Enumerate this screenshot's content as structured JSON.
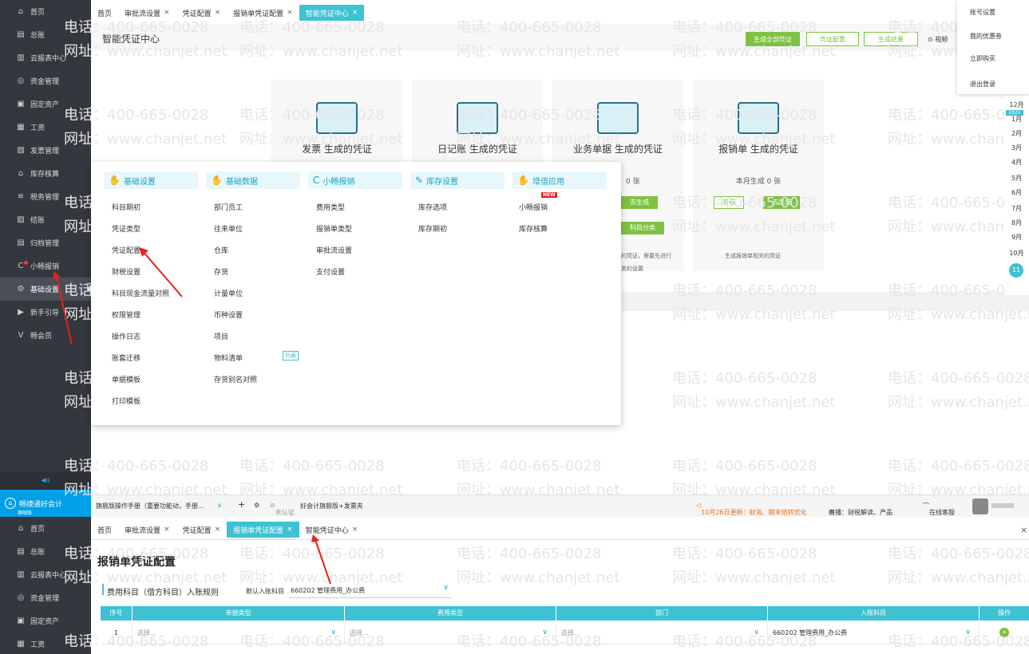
{
  "sidebar_top": [
    {
      "icon": "home-icon",
      "glyph": "⌂",
      "label": "首页"
    },
    {
      "icon": "ledger-icon",
      "glyph": "▤",
      "label": "总账"
    },
    {
      "icon": "chart-icon",
      "glyph": "▥",
      "label": "云报表中心"
    },
    {
      "icon": "money-icon",
      "glyph": "◎",
      "label": "资金管理"
    },
    {
      "icon": "asset-icon",
      "glyph": "▣",
      "label": "固定资产"
    },
    {
      "icon": "salary-icon",
      "glyph": "▦",
      "label": "工资"
    },
    {
      "icon": "invoice-icon",
      "glyph": "▧",
      "label": "发票管理"
    },
    {
      "icon": "warehouse-icon",
      "glyph": "⌂",
      "label": "库存核算"
    },
    {
      "icon": "tax-icon",
      "glyph": "≡",
      "label": "税务管理"
    },
    {
      "icon": "close-account-icon",
      "glyph": "▨",
      "label": "结账"
    },
    {
      "icon": "archive-icon",
      "glyph": "▤",
      "label": "归档管理"
    },
    {
      "icon": "reimburse-icon",
      "glyph": "C",
      "label": "小畅报销"
    },
    {
      "icon": "gear-icon",
      "glyph": "⚙",
      "label": "基础设置"
    },
    {
      "icon": "guide-icon",
      "glyph": "▶",
      "label": "新手引导"
    },
    {
      "icon": "vip-icon",
      "glyph": "V",
      "label": "畅会员"
    }
  ],
  "sidebar_bottom": [
    {
      "icon": "home-icon",
      "glyph": "⌂",
      "label": "首页"
    },
    {
      "icon": "ledger-icon",
      "glyph": "▤",
      "label": "总账"
    },
    {
      "icon": "chart-icon",
      "glyph": "▥",
      "label": "云报表中心"
    },
    {
      "icon": "money-icon",
      "glyph": "◎",
      "label": "资金管理"
    },
    {
      "icon": "asset-icon",
      "glyph": "▣",
      "label": "固定资产"
    },
    {
      "icon": "salary-icon",
      "glyph": "▦",
      "label": "工资"
    }
  ],
  "brand": {
    "name": "畅捷通好会计",
    "sub": "旗舰版"
  },
  "tabs_top": [
    {
      "label": "首页",
      "x": false
    },
    {
      "label": "审批流设置",
      "x": true
    },
    {
      "label": "凭证配置",
      "x": true
    },
    {
      "label": "报销单凭证配置",
      "x": true
    },
    {
      "label": "智能凭证中心",
      "x": true,
      "active": true
    }
  ],
  "tabs_bottom": [
    {
      "label": "首页",
      "x": false
    },
    {
      "label": "审批流设置",
      "x": true
    },
    {
      "label": "凭证配置",
      "x": true
    },
    {
      "label": "报销单凭证配置",
      "x": true,
      "active": true
    },
    {
      "label": "智能凭证中心",
      "x": true
    }
  ],
  "page_title": "智能凭证中心",
  "top_buttons": {
    "generate_all": "生成全部凭证",
    "voucher_config": "凭证配置",
    "result": "生成结果",
    "video": "视频"
  },
  "account_menu": [
    "账号设置",
    "我的优惠券",
    "立即购买",
    "退出登录"
  ],
  "months": [
    "12月",
    "2021",
    "1月",
    "2月",
    "3月",
    "4月",
    "5月",
    "6月",
    "7月",
    "8月",
    "9月",
    "10月",
    "11月"
  ],
  "cards": [
    {
      "title": "发票 生成的凭证"
    },
    {
      "title": "日记账 生成的凭证"
    },
    {
      "title": "业务单据 生成的凭证",
      "count": "0 张",
      "btn1": "去生成",
      "btn2": "科目分类",
      "note1": "的凭证，需要先进行",
      "note2": "类的设置"
    },
    {
      "title": "报销单 生成的凭证",
      "count": "本月生成  0 张",
      "btn1": "查看",
      "btn2": "去生成",
      "note1": "生成报销单相关的凭证"
    }
  ],
  "menu": {
    "col1": {
      "head": "基础设置",
      "items": [
        "科目期初",
        "凭证类型",
        "凭证配置",
        "财税设置",
        "科目现金流量对照",
        "权限管理",
        "操作日志",
        "账套迁移",
        "单据模板",
        "打印模板"
      ]
    },
    "col2": {
      "head": "基础数据",
      "items": [
        "部门员工",
        "往来单位",
        "仓库",
        "存货",
        "计量单位",
        "币种设置",
        "项目",
        "物料清单",
        "存货别名对照"
      ],
      "badge": "列表"
    },
    "col3": {
      "head": "小畅报销",
      "items": [
        "费用类型",
        "报销单类型",
        "审批流设置",
        "支付设置"
      ]
    },
    "col4": {
      "head": "库存设置",
      "items": [
        "库存选项",
        "库存期初"
      ]
    },
    "col5": {
      "head": "增值应用",
      "items": [
        "小畅报销",
        "库存核算"
      ],
      "new": "NEW"
    }
  },
  "status": {
    "manual": "旗舰版操作手册（重要功能动，手册...",
    "cert": "未认证",
    "cert_text": "好会计旗舰版+发票夹",
    "update": "10月26日更新：财海、期末结转优化",
    "live": "直播：财税解读、产品",
    "service": "在线客服"
  },
  "bottom": {
    "title": "报销单凭证配置",
    "rule_label": "费用科目（借方科目）入账规则",
    "default_label": "默认入账科目",
    "default_value": "660202 管理费用_办公费",
    "headers": [
      "序号",
      "单据类型",
      "费用类型",
      "部门",
      "入账科目",
      "操作"
    ],
    "row": {
      "no": "1",
      "doc_type": "选择...",
      "fee_type": "选择...",
      "dept": "选择...",
      "account": "660202 管理费用_办公费"
    }
  },
  "watermark": {
    "phone": "电话：400-665-0028",
    "site": "网址：www.chanjet.net"
  }
}
